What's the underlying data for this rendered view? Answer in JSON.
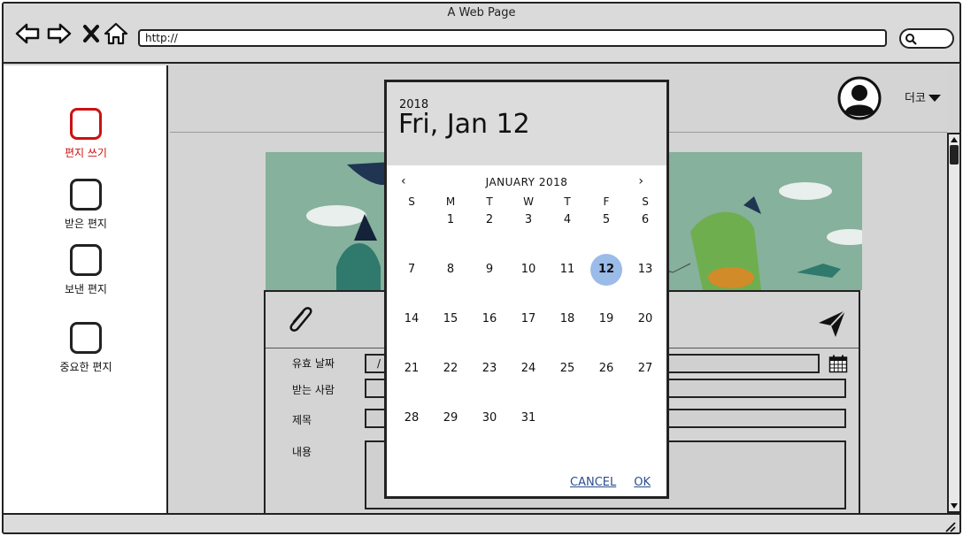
{
  "window": {
    "title": "A Web Page"
  },
  "browser": {
    "url": "http://",
    "nav_icons": [
      "back-arrow-icon",
      "forward-arrow-icon",
      "close-x-icon",
      "home-icon"
    ]
  },
  "sidebar": {
    "items": [
      {
        "label": "편지 쓰기",
        "active": true
      },
      {
        "label": "받은 편지",
        "active": false
      },
      {
        "label": "보낸 편지",
        "active": false
      },
      {
        "label": "중요한 편지",
        "active": false
      }
    ]
  },
  "header": {
    "user_menu_label": "더코"
  },
  "form": {
    "date_label": "유효 날짜",
    "date_value": "/",
    "recipient_label": "받는 사람",
    "subject_label": "제목",
    "content_label": "내용"
  },
  "datepicker": {
    "year": "2018",
    "selected_label": "Fri, Jan 12",
    "month_title": "JANUARY 2018",
    "prev": "‹",
    "next": "›",
    "weekdays": [
      "S",
      "M",
      "T",
      "W",
      "T",
      "F",
      "S"
    ],
    "days": [
      "1",
      "2",
      "3",
      "4",
      "5",
      "6",
      "7",
      "8",
      "9",
      "10",
      "11",
      "12",
      "13",
      "14",
      "15",
      "16",
      "17",
      "18",
      "19",
      "20",
      "21",
      "22",
      "23",
      "24",
      "25",
      "26",
      "27",
      "28",
      "29",
      "30",
      "31"
    ],
    "first_weekday_index": 1,
    "selected_day": "12",
    "cancel_label": "CANCEL",
    "ok_label": "OK",
    "accent_color": "#9bbbe9"
  },
  "colors": {
    "active_nav": "#cc1111",
    "link": "#2a4f8f"
  }
}
